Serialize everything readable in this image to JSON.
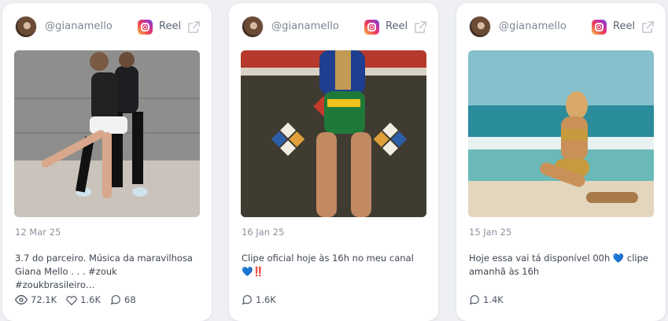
{
  "cards": [
    {
      "handle": "@gianamello",
      "platform_label": "Reel",
      "date": "12 Mar 25",
      "caption": "3.7 do parceiro. Música da maravilhosa Giana Mello . . . #zouk #zoukbrasileiro…",
      "views": "72.1K",
      "likes": "1.6K",
      "comments": "68"
    },
    {
      "handle": "@gianamello",
      "platform_label": "Reel",
      "date": "16 Jan 25",
      "caption": "Clipe oficial hoje às 16h no meu canal 💙‼️",
      "comments": "1.6K"
    },
    {
      "handle": "@gianamello",
      "platform_label": "Reel",
      "date": "15 Jan 25",
      "caption": "Hoje essa vai tá disponível 00h 💙 clipe amanhã às 16h",
      "comments": "1.4K"
    }
  ],
  "icons": {
    "platform": "instagram-icon",
    "external": "external-link-icon",
    "views": "eye-icon",
    "likes": "heart-icon",
    "comments": "comment-icon"
  },
  "colors": {
    "page_bg": "#eef0f3",
    "card_bg": "#ffffff",
    "muted_text": "#8b93a0",
    "body_text": "#3e4551"
  }
}
